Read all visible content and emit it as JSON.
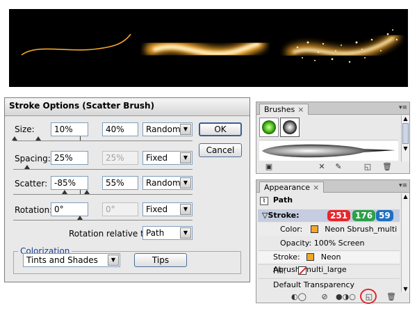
{
  "dialog": {
    "title": "Stroke Options (Scatter Brush)",
    "rows": [
      {
        "label": "Size:",
        "min": "10%",
        "max": "40%",
        "mode": "Random"
      },
      {
        "label": "Spacing:",
        "min": "25%",
        "max": "25%",
        "mode": "Fixed"
      },
      {
        "label": "Scatter:",
        "min": "-85%",
        "max": "55%",
        "mode": "Random"
      },
      {
        "label": "Rotation:",
        "min": "0°",
        "max": "0°",
        "mode": "Fixed"
      }
    ],
    "rotation_relative_label": "Rotation relative to:",
    "rotation_relative_value": "Path",
    "ok_label": "OK",
    "cancel_label": "Cancel",
    "colorization_label": "Colorization",
    "colorization_value": "Tints and Shades",
    "tips_label": "Tips"
  },
  "brushes": {
    "tab_label": "Brushes",
    "close_glyph": "×",
    "menu_glyph": "▾≡"
  },
  "appearance": {
    "tab_label": "Appearance",
    "close_glyph": "×",
    "path_label": "Path",
    "stroke_header": "▽Stroke:",
    "rgb": {
      "r": "251",
      "g": "176",
      "b": "59"
    },
    "rgb_colors": {
      "r": "#e8262c",
      "g": "#2ca04a",
      "b": "#1d6fc0"
    },
    "color_label": "Color:",
    "color_value": "Neon Sbrush_multi",
    "opacity_text": "Opacity: 100% Screen",
    "stroke2_label": "Stroke:",
    "stroke2_value": "Neon Abrush_multi_large",
    "fill_label": "Fill:",
    "transparency_label": "Default Transparency",
    "swatch_color": "#f3a629"
  }
}
